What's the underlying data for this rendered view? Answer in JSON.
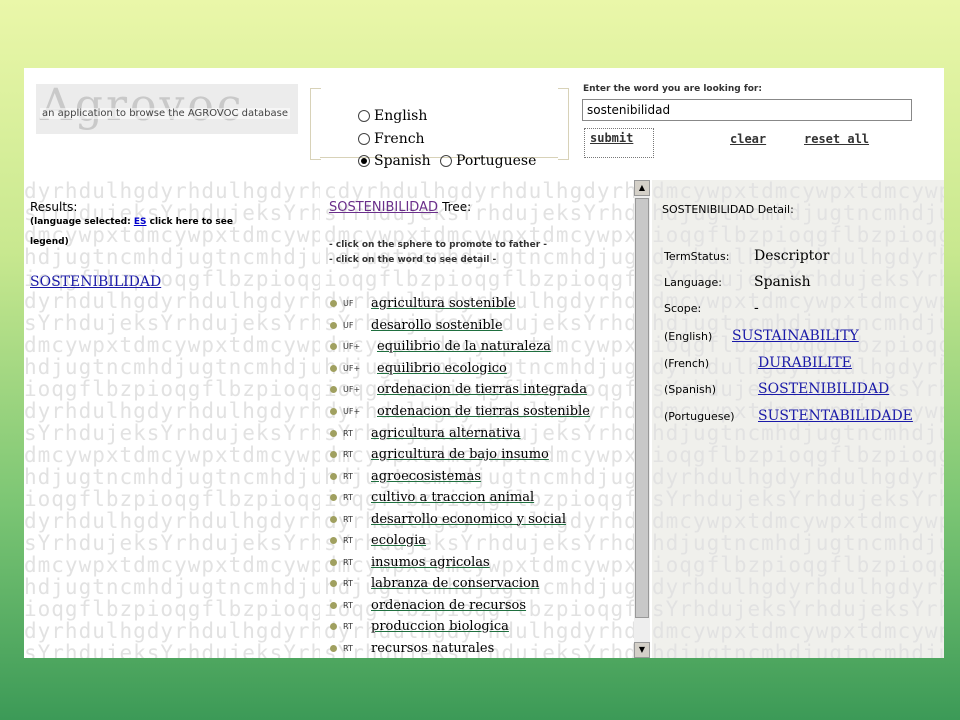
{
  "header": {
    "logo_word": "Agrovoc",
    "logo_tagline": "an application to browse the AGROVOC database",
    "languages": [
      {
        "label": "English",
        "selected": false
      },
      {
        "label": "French",
        "selected": false
      },
      {
        "label": "Spanish",
        "selected": true
      },
      {
        "label": "Portuguese",
        "selected": false
      }
    ],
    "search_label": "Enter the word you are looking for:",
    "search_value": "sostenibilidad",
    "submit_label": "submit",
    "clear_label": "clear",
    "reset_label": "reset all"
  },
  "results": {
    "title": "Results:",
    "lang_prefix": "(language selected:",
    "lang_code": "ES",
    "lang_suffix": "click here to see",
    "legend_text": "legend)",
    "item": "SOSTENIBILIDAD"
  },
  "tree": {
    "term": "SOSTENIBILIDAD",
    "suffix": "Tree:",
    "hint1": "- click on the sphere to promote to father -",
    "hint2": "- click on the word to see detail -",
    "rows": [
      {
        "rel": "UF",
        "term": "agricultura sostenible"
      },
      {
        "rel": "UF",
        "term": "desarollo sostenible"
      },
      {
        "rel": "UF+",
        "term": "equilibrio de la naturaleza"
      },
      {
        "rel": "UF+",
        "term": "equilibrio ecologico"
      },
      {
        "rel": "UF+",
        "term": "ordenacion de tierras integrada"
      },
      {
        "rel": "UF+",
        "term": "ordenacion de tierras sostenible"
      },
      {
        "rel": "RT",
        "term": "agricultura alternativa"
      },
      {
        "rel": "RT",
        "term": "agricultura de bajo insumo"
      },
      {
        "rel": "RT",
        "term": "agroecosistemas"
      },
      {
        "rel": "RT",
        "term": "cultivo a traccion animal"
      },
      {
        "rel": "RT",
        "term": "desarrollo economico y social"
      },
      {
        "rel": "RT",
        "term": "ecologia"
      },
      {
        "rel": "RT",
        "term": "insumos agricolas"
      },
      {
        "rel": "RT",
        "term": "labranza de conservacion"
      },
      {
        "rel": "RT",
        "term": "ordenacion de recursos"
      },
      {
        "rel": "RT",
        "term": "produccion biologica"
      },
      {
        "rel": "RT",
        "term": "recursos naturales"
      }
    ]
  },
  "detail": {
    "term": "SOSTENIBILIDAD",
    "suffix": "Detail:",
    "status_key": "TermStatus:",
    "status_val": "Descriptor",
    "language_key": "Language:",
    "language_val": "Spanish",
    "scope_key": "Scope:",
    "scope_val": "-",
    "translations": [
      {
        "lang": "(English)",
        "term": "SUSTAINABILITY"
      },
      {
        "lang": "(French)",
        "term": "DURABILITE"
      },
      {
        "lang": "(Spanish)",
        "term": "SOSTENIBILIDAD"
      },
      {
        "lang": "(Portuguese)",
        "term": "SUSTENTABILIDADE"
      }
    ]
  }
}
